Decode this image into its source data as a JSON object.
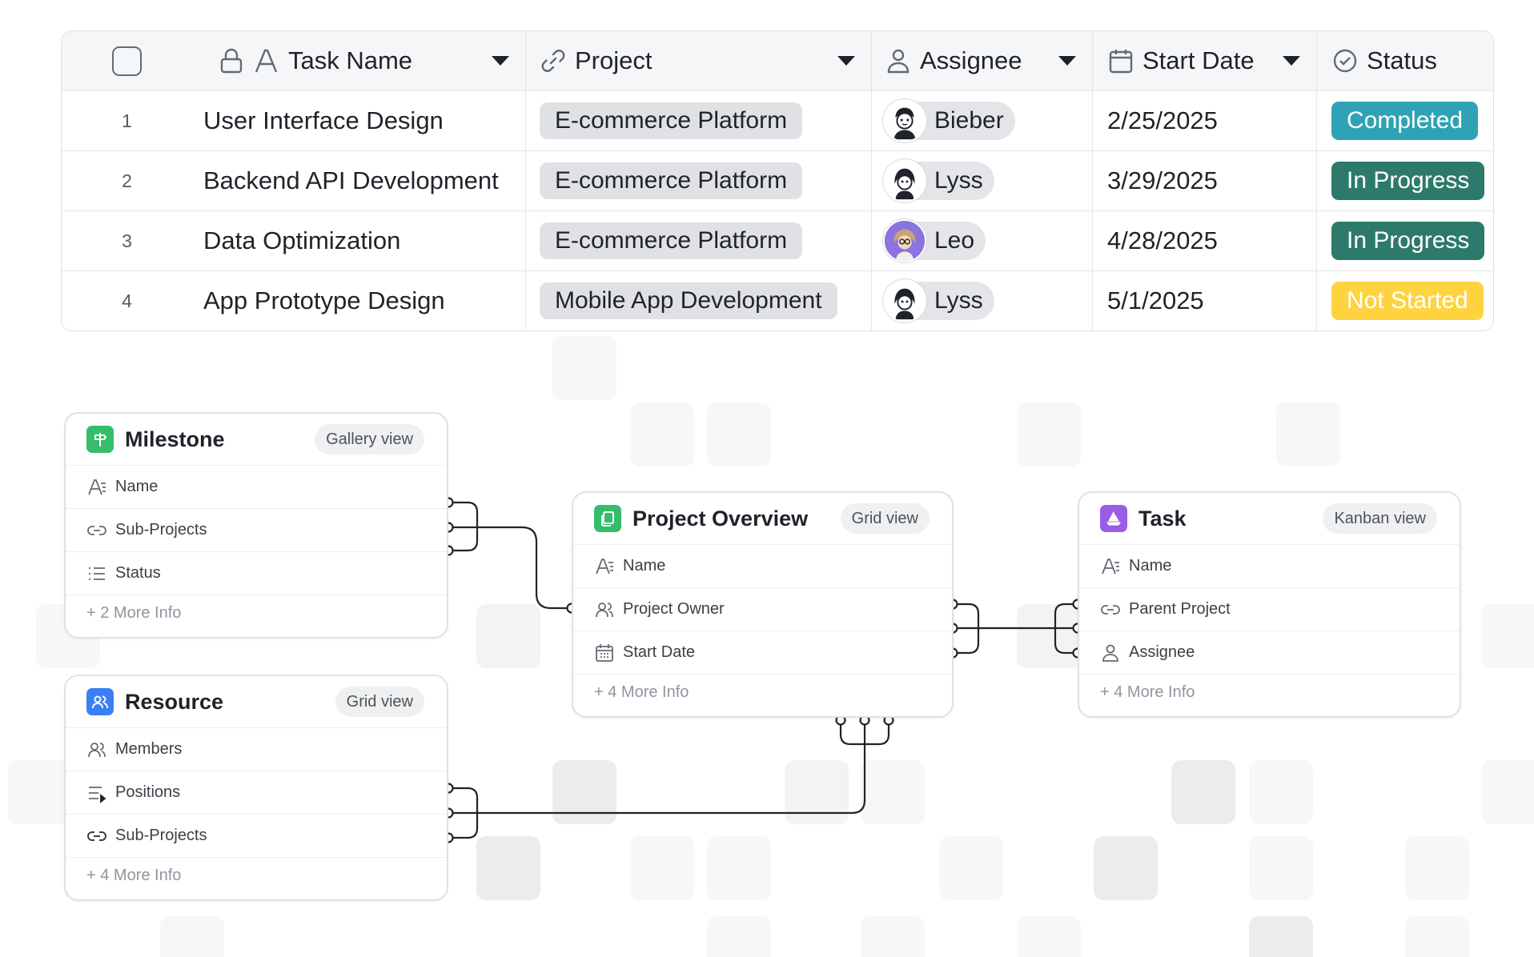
{
  "table": {
    "headers": {
      "task_name": "Task Name",
      "project": "Project",
      "assignee": "Assignee",
      "start_date": "Start Date",
      "status": "Status"
    },
    "header_icons": [
      "checkbox-icon",
      "lock-icon",
      "text-field-icon",
      "link-icon",
      "person-icon",
      "calendar-icon",
      "check-circle-icon"
    ],
    "rows": [
      {
        "index": "1",
        "task": "User Interface Design",
        "project": "E-commerce Platform",
        "assignee": "Bieber",
        "start_date": "2/25/2025",
        "status": "Completed"
      },
      {
        "index": "2",
        "task": "Backend API Development",
        "project": "E-commerce Platform",
        "assignee": "Lyss",
        "start_date": "3/29/2025",
        "status": "In Progress"
      },
      {
        "index": "3",
        "task": "Data Optimization",
        "project": "E-commerce Platform",
        "assignee": "Leo",
        "start_date": "4/28/2025",
        "status": "In Progress"
      },
      {
        "index": "4",
        "task": "App Prototype Design",
        "project": "Mobile App Development",
        "assignee": "Lyss",
        "start_date": "5/1/2025",
        "status": "Not Started"
      }
    ],
    "status_colors": {
      "Completed": "#2fa3b5",
      "In Progress": "#2d7a6a",
      "Not Started": "#ffd340"
    }
  },
  "cards": {
    "milestone": {
      "title": "Milestone",
      "view": "Gallery view",
      "icon": "signpost-icon",
      "color": "#35bd6b",
      "fields": [
        "Name",
        "Sub-Projects",
        "Status"
      ],
      "more": "+ 2 More Info"
    },
    "resource": {
      "title": "Resource",
      "view": "Grid view",
      "icon": "people-icon",
      "color": "#3b7ff5",
      "fields": [
        "Members",
        "Positions",
        "Sub-Projects"
      ],
      "more": "+ 4 More Info"
    },
    "project_overview": {
      "title": "Project Overview",
      "view": "Grid view",
      "icon": "document-icon",
      "color": "#35bd6b",
      "fields": [
        "Name",
        "Project Owner",
        "Start Date"
      ],
      "more": "+ 4 More Info"
    },
    "task": {
      "title": "Task",
      "view": "Kanban view",
      "icon": "sailboat-icon",
      "color": "#9b5de5",
      "fields": [
        "Name",
        "Parent Project",
        "Assignee"
      ],
      "more": "+ 4 More Info"
    }
  }
}
